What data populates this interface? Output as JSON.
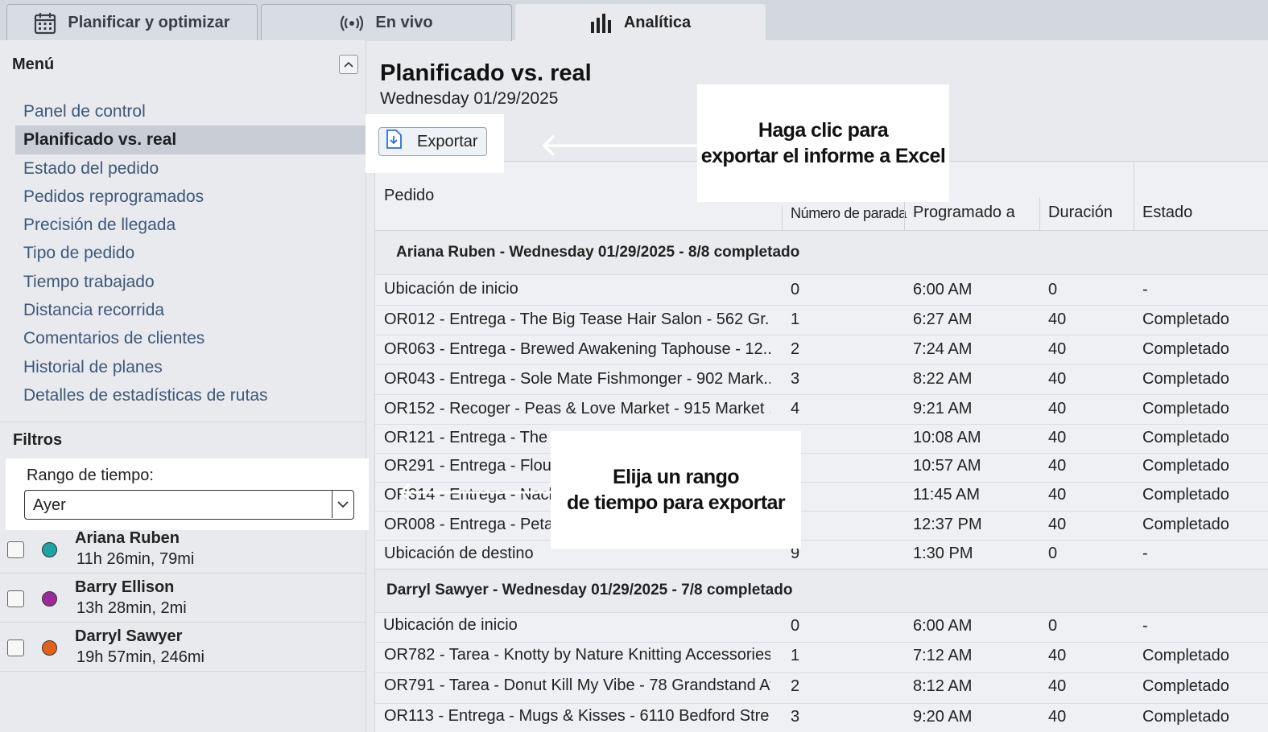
{
  "tabs": [
    {
      "label": "Planificar y optimizar",
      "icon": "calendar-icon"
    },
    {
      "label": "En vivo",
      "icon": "broadcast-icon"
    },
    {
      "label": "Analítica",
      "icon": "bar-chart-icon"
    }
  ],
  "sidebar": {
    "menu_title": "Menú",
    "menu_items": [
      {
        "label": "Panel de control"
      },
      {
        "label": "Planificado vs. real"
      },
      {
        "label": "Estado del pedido"
      },
      {
        "label": "Pedidos reprogramados"
      },
      {
        "label": "Precisión de llegada"
      },
      {
        "label": "Tipo de pedido"
      },
      {
        "label": "Tiempo trabajado"
      },
      {
        "label": "Distancia recorrida"
      },
      {
        "label": "Comentarios de clientes"
      },
      {
        "label": "Historial de planes"
      },
      {
        "label": "Detalles de estadísticas de rutas"
      }
    ],
    "filters_title": "Filtros",
    "time_range_label": "Rango de tiempo:",
    "time_range_value": "Ayer",
    "drivers": [
      {
        "name": "Ariana Ruben",
        "stats": "11h 26min, 79mi",
        "color": "#1fa3a3"
      },
      {
        "name": "Barry Ellison",
        "stats": "13h 28min, 2mi",
        "color": "#9b2a9b"
      },
      {
        "name": "Darryl Sawyer",
        "stats": "19h 57min, 246mi",
        "color": "#e0621d"
      }
    ]
  },
  "main": {
    "title": "Planificado vs. real",
    "date": "Wednesday 01/29/2025",
    "export_label": "Exportar",
    "columns": {
      "order": "Pedido",
      "stop": "Número de parada",
      "scheduled": "Programado a",
      "duration": "Duración",
      "status": "Estado"
    },
    "groups": [
      {
        "header": "Ariana Ruben - Wednesday 01/29/2025 - 8/8 completado",
        "rows": [
          {
            "order": "Ubicación de inicio",
            "stop": "0",
            "scheduled": "6:00 AM",
            "duration": "0",
            "status": "-"
          },
          {
            "order": "OR012 - Entrega - The Big Tease Hair Salon - 562 Gr...",
            "stop": "1",
            "scheduled": "6:27 AM",
            "duration": "40",
            "status": "Completado"
          },
          {
            "order": "OR063 - Entrega - Brewed Awakening Taphouse - 12...",
            "stop": "2",
            "scheduled": "7:24 AM",
            "duration": "40",
            "status": "Completado"
          },
          {
            "order": "OR043 - Entrega - Sole Mate Fishmonger - 902 Mark...",
            "stop": "3",
            "scheduled": "8:22 AM",
            "duration": "40",
            "status": "Completado"
          },
          {
            "order": "OR152 - Recoger - Peas & Love Market - 915 Market ...",
            "stop": "4",
            "scheduled": "9:21 AM",
            "duration": "40",
            "status": "Completado"
          },
          {
            "order": "OR121 - Entrega - The C",
            "stop": "",
            "scheduled": "10:08 AM",
            "duration": "40",
            "status": "Completado"
          },
          {
            "order": "OR291 - Entrega - Flourı",
            "stop": "",
            "scheduled": "10:57 AM",
            "duration": "40",
            "status": "Completado"
          },
          {
            "order": "OR314 - Entrega - Nachı",
            "stop": "",
            "scheduled": "11:45 AM",
            "duration": "40",
            "status": "Completado"
          },
          {
            "order": "OR008 - Entrega - Petali",
            "stop": "",
            "scheduled": "12:37 PM",
            "duration": "40",
            "status": "Completado"
          },
          {
            "order": "Ubicación de destino",
            "stop": "9",
            "scheduled": "1:30 PM",
            "duration": "0",
            "status": "-"
          }
        ]
      },
      {
        "header": "Darryl Sawyer - Wednesday 01/29/2025 - 7/8 completado",
        "rows": [
          {
            "order": "Ubicación de inicio",
            "stop": "0",
            "scheduled": "6:00 AM",
            "duration": "0",
            "status": "-"
          },
          {
            "order": "OR782 - Tarea - Knotty by Nature Knitting Accessories...",
            "stop": "1",
            "scheduled": "7:12 AM",
            "duration": "40",
            "status": "Completado"
          },
          {
            "order": "OR791 - Tarea - Donut Kill My Vibe - 78 Grandstand Av...",
            "stop": "2",
            "scheduled": "8:12 AM",
            "duration": "40",
            "status": "Completado"
          },
          {
            "order": "OR113 - Entrega - Mugs & Kisses - 6110 Bedford Stre...",
            "stop": "3",
            "scheduled": "9:20 AM",
            "duration": "40",
            "status": "Completado"
          }
        ]
      }
    ]
  },
  "callouts": {
    "export": [
      "Haga clic para",
      "exportar el informe a Excel"
    ],
    "range": [
      "Elija un rango",
      "de tiempo para exportar"
    ]
  }
}
